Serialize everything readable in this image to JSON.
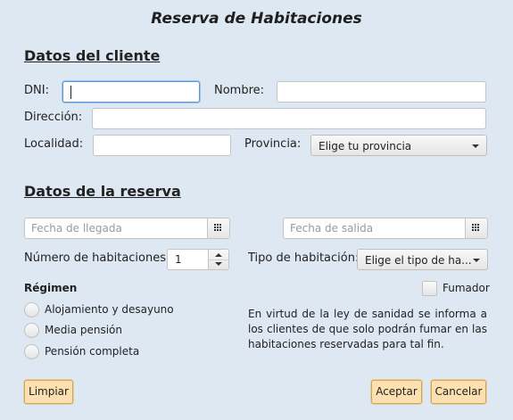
{
  "window": {
    "title": "Reserva de Habitaciones"
  },
  "cliente": {
    "heading": "Datos del cliente",
    "dni_label": "DNI:",
    "dni_value": "",
    "nombre_label": "Nombre:",
    "nombre_value": "",
    "direccion_label": "Dirección:",
    "direccion_value": "",
    "localidad_label": "Localidad:",
    "localidad_value": "",
    "provincia_label": "Provincia:",
    "provincia_selected": "Elige tu provincia"
  },
  "reserva": {
    "heading": "Datos de la reserva",
    "fecha_llegada_placeholder": "Fecha de llegada",
    "fecha_salida_placeholder": "Fecha de salida",
    "num_habitaciones_label": "Número de habitaciones:",
    "num_habitaciones_value": "1",
    "tipo_habitacion_label": "Tipo de habitación:",
    "tipo_habitacion_selected": "Elige el tipo de ha...",
    "regimen_label": "Régimen",
    "regimen_options": [
      "Alojamiento y desayuno",
      "Media pensión",
      "Pensión completa"
    ],
    "fumador_label": "Fumador",
    "info_text": "En virtud de la ley de sanidad se informa a los clientes de que solo podrán fumar en las habitaciones reservadas para tal fin."
  },
  "buttons": {
    "limpiar": "Limpiar",
    "aceptar": "Aceptar",
    "cancelar": "Cancelar"
  },
  "colors": {
    "background": "#dde8f2",
    "button": "#fde0b0",
    "focus": "#5b9bd5"
  }
}
